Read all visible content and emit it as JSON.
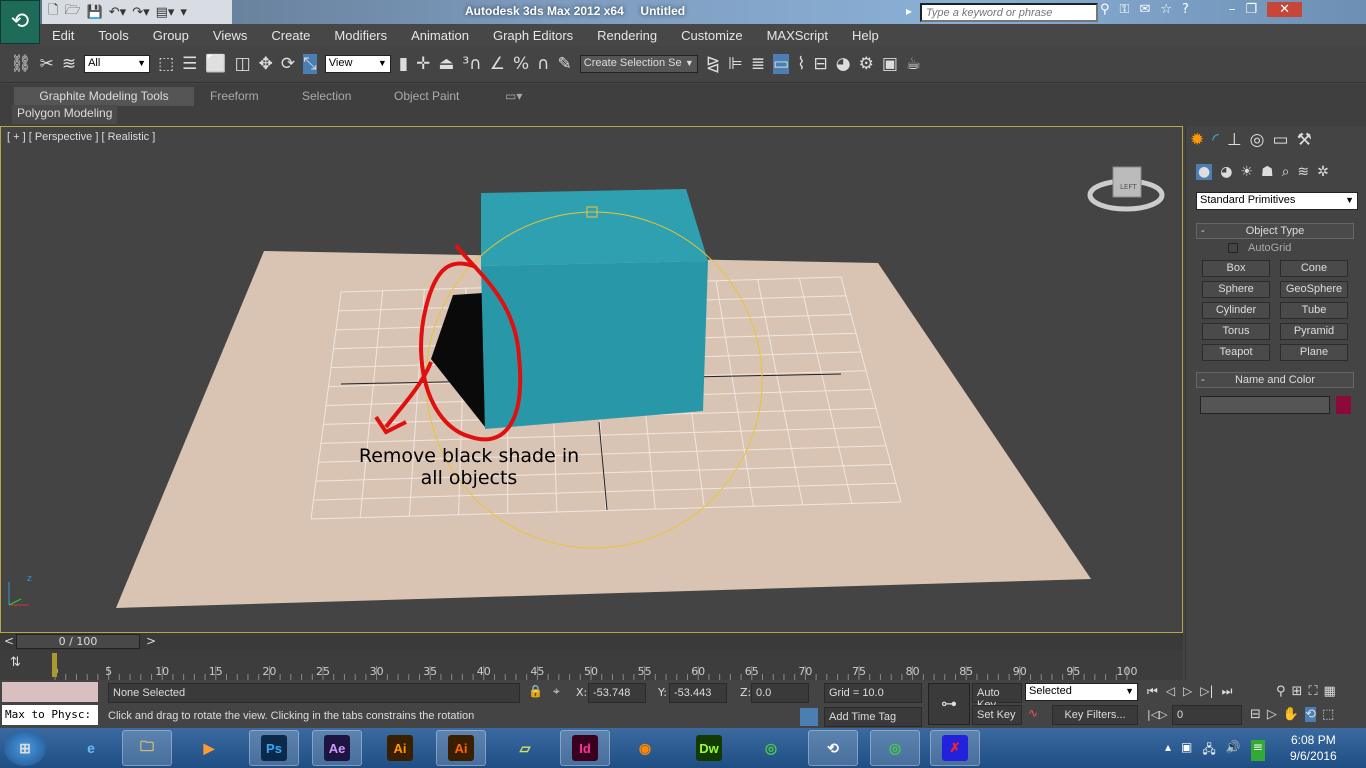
{
  "title": {
    "app": "Autodesk 3ds Max  2012 x64",
    "doc": "Untitled",
    "search_placeholder": "Type a keyword or phrase"
  },
  "menu": [
    "Edit",
    "Tools",
    "Group",
    "Views",
    "Create",
    "Modifiers",
    "Animation",
    "Graph Editors",
    "Rendering",
    "Customize",
    "MAXScript",
    "Help"
  ],
  "toolbar": {
    "filter": "All",
    "ref_coord": "View",
    "selection_set": "Create Selection Se"
  },
  "ribbon": {
    "tabs": [
      "Graphite Modeling Tools",
      "Freeform",
      "Selection",
      "Object Paint"
    ],
    "panel": "Polygon Modeling"
  },
  "viewport": {
    "label": "[ + ] [ Perspective ] [ Realistic ]",
    "annotation_line1": "Remove black shade in",
    "annotation_line2": "all objects",
    "viewcube_face": "LEFT",
    "colors": {
      "plane": "#d9c4b4",
      "box": "#2b9bab",
      "annotation": "#e01010",
      "selection_gizmo": "#e8c33a"
    }
  },
  "command_panel": {
    "category": "Standard Primitives",
    "object_type_title": "Object Type",
    "autogrid": "AutoGrid",
    "autogrid_checked": false,
    "buttons": [
      "Box",
      "Cone",
      "Sphere",
      "GeoSphere",
      "Cylinder",
      "Tube",
      "Torus",
      "Pyramid",
      "Teapot",
      "Plane"
    ],
    "name_color_title": "Name and Color",
    "name_value": "",
    "object_color": "#8b0a3a"
  },
  "timeline": {
    "slider": "0 / 100",
    "ticks": [
      "0",
      "5",
      "10",
      "15",
      "20",
      "25",
      "30",
      "35",
      "40",
      "45",
      "50",
      "55",
      "60",
      "65",
      "70",
      "75",
      "80",
      "85",
      "90",
      "95",
      "100"
    ]
  },
  "status": {
    "selection": "None Selected",
    "prompt": "Click and drag to rotate the view.  Clicking in the tabs constrains the rotation",
    "x_label": "X:",
    "x": "-53.748",
    "y_label": "Y:",
    "y": "-53.443",
    "z_label": "Z:",
    "z": "0.0",
    "grid": "Grid = 10.0",
    "auto_key": "Auto Key",
    "set_key": "Set Key",
    "key_mode": "Selected",
    "key_filters": "Key Filters...",
    "add_time_tag": "Add Time Tag",
    "frame": "0",
    "script_listener": "Max to Physc:"
  },
  "taskbar": {
    "apps": [
      "Ps",
      "Ae",
      "Ai",
      "Ai",
      "Id",
      "Dw"
    ],
    "time": "6:08 PM",
    "date": "9/6/2016"
  }
}
